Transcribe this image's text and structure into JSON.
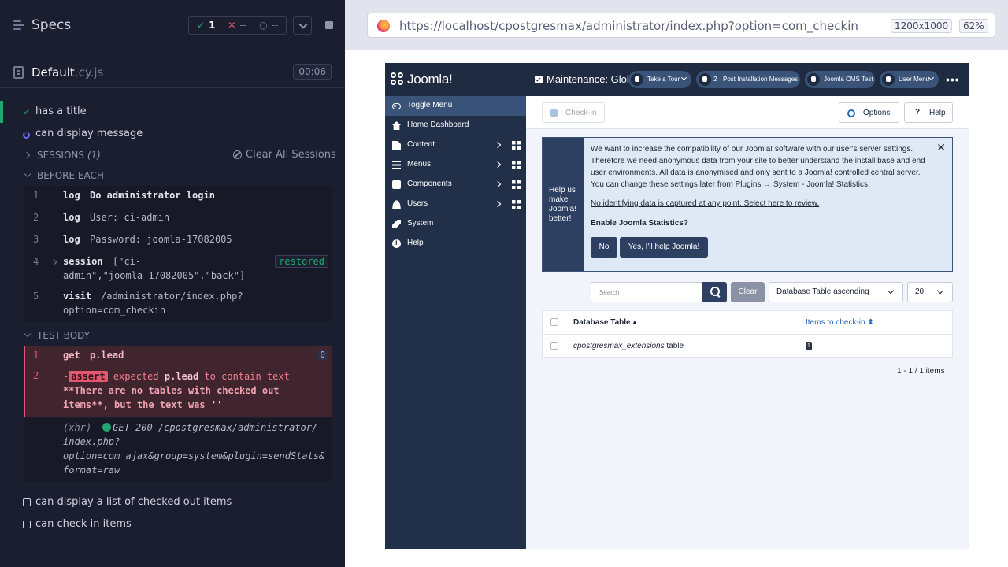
{
  "reporter": {
    "header": {
      "title": "Specs",
      "passed": "1",
      "failed": "--",
      "pending": "--"
    },
    "spec": {
      "name": "Default",
      "ext": ".cy.js",
      "duration": "00:06"
    },
    "tests": [
      {
        "title": "has a title",
        "state": "passed"
      },
      {
        "title": "can display message",
        "state": "running"
      },
      {
        "title": "can display a list of checked out items",
        "state": "pending"
      },
      {
        "title": "can check in items",
        "state": "pending"
      }
    ],
    "sessions": {
      "label": "SESSIONS",
      "count": "(1)",
      "clear": "Clear All Sessions"
    },
    "before_each": {
      "label": "BEFORE EACH",
      "commands": [
        {
          "num": "1",
          "name": "log",
          "msg": "Do administrator login"
        },
        {
          "num": "2",
          "name": "log",
          "msg": "User: ci-admin"
        },
        {
          "num": "3",
          "name": "log",
          "msg": "Password: joomla-17082005"
        },
        {
          "num": "4",
          "name": "session",
          "msg1": "[\"ci-",
          "msg2": "admin\",\"joomla-17082005\",\"back\"]",
          "badge": "restored"
        },
        {
          "num": "5",
          "name": "visit",
          "msg1": "/administrator/index.php?",
          "msg2": "option=com_checkin"
        }
      ]
    },
    "test_body": {
      "label": "TEST BODY",
      "get": {
        "num": "1",
        "name": "get",
        "msg": "p.lead",
        "badge": "0"
      },
      "assert": {
        "num": "2",
        "prefix": "-",
        "tag": "assert",
        "line1a": "expected",
        "line1b": "p.lead",
        "line1c": "to contain text",
        "line2": "**There are no tables with checked out",
        "line3": "items**, but the text was",
        "line3b": "''"
      },
      "xhr": {
        "label": "(xhr)",
        "line1": "GET 200 /cpostgresmax/administrator/",
        "line2": "index.php?",
        "line3": "option=com_ajax&group=system&plugin=sendStats&",
        "line4": "format=raw"
      }
    }
  },
  "aut": {
    "url": "https://localhost/cpostgresmax/administrator/index.php?option=com_checkin",
    "viewport": "1200x1000",
    "zoom": "62%",
    "joomla": {
      "logo": "Joomla!",
      "sidebar": [
        {
          "label": "Toggle Menu",
          "icon": "toggle-icon"
        },
        {
          "label": "Home Dashboard",
          "icon": "home-icon"
        },
        {
          "label": "Content",
          "icon": "file-icon"
        },
        {
          "label": "Menus",
          "icon": "list-icon"
        },
        {
          "label": "Components",
          "icon": "puzzle-icon"
        },
        {
          "label": "Users",
          "icon": "users-icon"
        },
        {
          "label": "System",
          "icon": "wrench-icon"
        },
        {
          "label": "Help",
          "icon": "info-icon"
        }
      ],
      "page_title": "Maintenance: Global Check-in",
      "header_pills": {
        "tour": "Take a Tour",
        "post_install_count": "2",
        "post_install": "Post Installation Messages",
        "site": "Joomla CMS Test",
        "user": "User Menu"
      },
      "toolbar": {
        "checkin": "Check-in",
        "options": "Options",
        "help": "Help"
      },
      "stats_alert": {
        "side": "Help us make Joomla! better!",
        "body": "We want to increase the compatibility of our Joomla! software with our user's server settings. Therefore we need anonymous data from your site to better understand the install base and end user environments. All data is anonymised and only sent to a Joomla! controlled central server. You can change these settings later from Plugins → System - Joomla! Statistics.",
        "link": "No identifying data is captured at any point. Select here to review.",
        "question": "Enable Joomla Statistics?",
        "no": "No",
        "yes": "Yes, I'll help Joomla!"
      },
      "filters": {
        "search_placeholder": "Search",
        "clear": "Clear",
        "ordering": "Database Table ascending",
        "limit": "20"
      },
      "table": {
        "col_table": "Database Table",
        "col_items": "Items to check-in",
        "rows": [
          {
            "table_name": "cpostgresmax_extensions",
            "suffix": "table",
            "items": "1"
          }
        ]
      },
      "pagination": "1 - 1 / 1 items"
    }
  }
}
